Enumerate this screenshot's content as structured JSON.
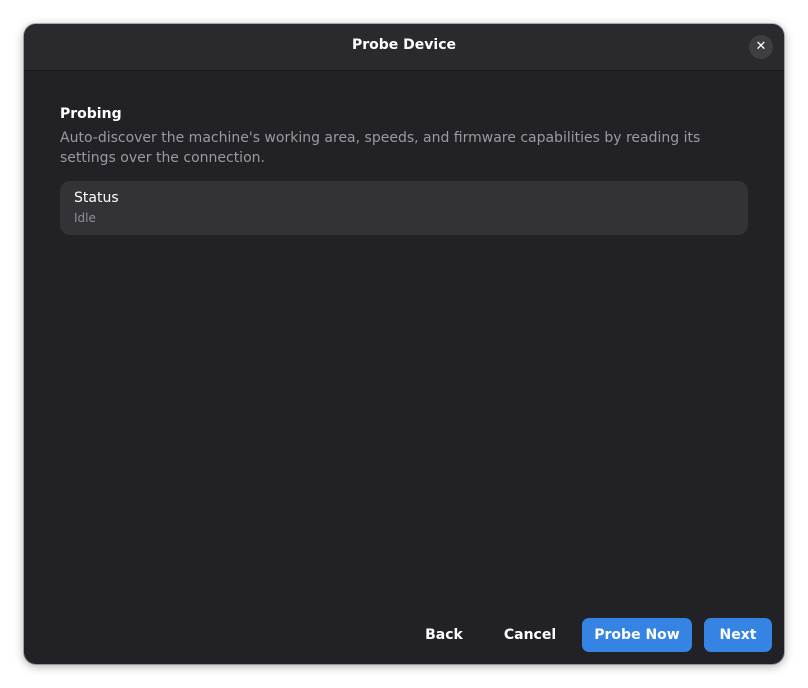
{
  "dialog": {
    "title": "Probe Device",
    "close_icon": "close-icon"
  },
  "section": {
    "title": "Probing",
    "description": "Auto-discover the machine's working area, speeds, and firmware capabilities by reading its settings over the connection."
  },
  "status": {
    "label": "Status",
    "value": "Idle"
  },
  "buttons": {
    "back": "Back",
    "cancel": "Cancel",
    "probe_now": "Probe Now",
    "next": "Next"
  },
  "colors": {
    "accent": "#3584e4",
    "window_bg": "#222226",
    "card_bg": "#323237"
  }
}
